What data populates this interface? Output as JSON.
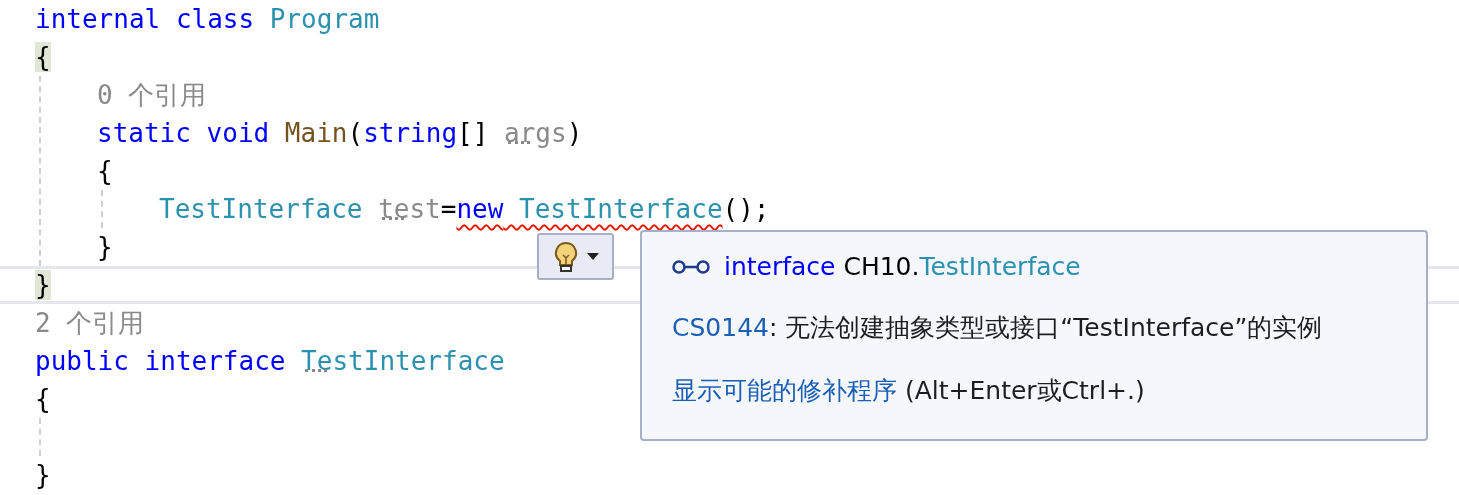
{
  "code": [
    {
      "tokens": [
        {
          "kind": "keyword",
          "text": "internal"
        },
        {
          "kind": "keyword",
          "text": " class"
        },
        {
          "kind": "type",
          "text": " Program"
        }
      ]
    },
    {
      "tokens": [
        {
          "kind": "plain",
          "text": "{",
          "highlighted": true
        }
      ],
      "children": [
        {
          "tokens": [
            {
              "kind": "codelens",
              "text": "0 个引用"
            }
          ]
        },
        {
          "tokens": [
            {
              "kind": "keyword",
              "text": "static"
            },
            {
              "kind": "keyword",
              "text": " void"
            },
            {
              "kind": "method",
              "text": " Main"
            },
            {
              "kind": "plain",
              "text": "("
            },
            {
              "kind": "keyword",
              "text": "string"
            },
            {
              "kind": "plain",
              "text": "[] "
            },
            {
              "kind": "faded",
              "text": "args",
              "hint": true
            },
            {
              "kind": "plain",
              "text": ")"
            }
          ]
        },
        {
          "tokens": [
            {
              "kind": "plain",
              "text": "{"
            }
          ],
          "children": [
            {
              "tokens": [
                {
                  "kind": "type",
                  "text": "TestInterface"
                },
                {
                  "kind": "faded",
                  "text": " test",
                  "hint": true
                },
                {
                  "kind": "plain",
                  "text": "="
                },
                {
                  "kind": "keyword",
                  "text": "new",
                  "error": true
                },
                {
                  "kind": "type",
                  "text": " TestInterface",
                  "error": true
                },
                {
                  "kind": "plain",
                  "text": "();"
                }
              ]
            }
          ]
        },
        {
          "tokens": [
            {
              "kind": "plain",
              "text": "}"
            }
          ]
        }
      ]
    },
    {
      "tokens": [
        {
          "kind": "plain",
          "text": "}",
          "highlighted": true
        }
      ],
      "separated": true
    },
    {
      "tokens": [
        {
          "kind": "codelens",
          "text": "2 个引用"
        }
      ]
    },
    {
      "tokens": [
        {
          "kind": "keyword",
          "text": "public"
        },
        {
          "kind": "keyword",
          "text": " interface"
        },
        {
          "kind": "type",
          "text": " TestInterface",
          "hint": true
        }
      ]
    },
    {
      "tokens": [
        {
          "kind": "plain",
          "text": "{"
        }
      ],
      "children": [
        {
          "kind": "blank"
        }
      ]
    },
    {
      "tokens": [
        {
          "kind": "plain",
          "text": "}"
        }
      ]
    }
  ],
  "quick_info": {
    "symbol": [
      {
        "kind": "keyword",
        "text": "interface"
      },
      {
        "kind": "plain",
        "text": " CH10."
      },
      {
        "kind": "type",
        "text": "TestInterface"
      }
    ],
    "error_code": "CS0144",
    "error_message": ": 无法创建抽象类型或接口“TestInterface”的实例",
    "fix_link": "显示可能的修补程序",
    "fix_shortcut": " (Alt+Enter或Ctrl+.)"
  }
}
